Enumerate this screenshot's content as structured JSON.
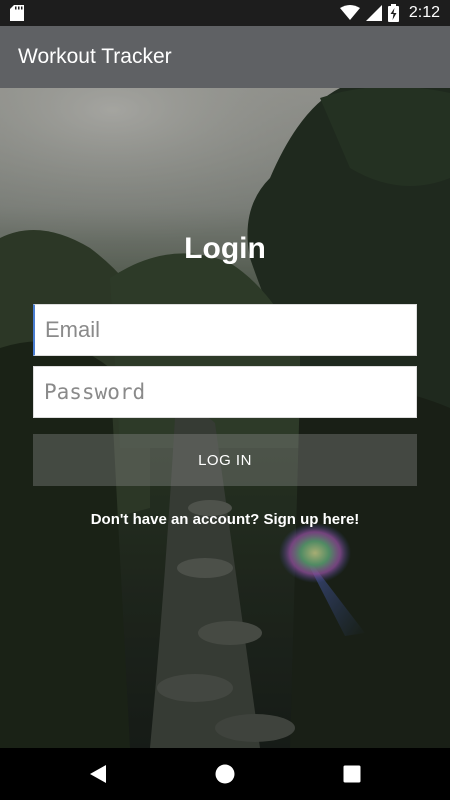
{
  "status_bar": {
    "time": "2:12",
    "icons": [
      "sd-card-icon",
      "wifi-icon",
      "signal-icon",
      "battery-charging-icon"
    ]
  },
  "app_bar": {
    "title": "Workout Tracker"
  },
  "login": {
    "title": "Login",
    "email_placeholder": "Email",
    "password_placeholder": "Password",
    "button_label": "LOG IN",
    "signup_text": "Don't have an account? Sign up here!"
  },
  "nav_bar": {
    "icons": [
      "back-icon",
      "home-icon",
      "recents-icon"
    ]
  },
  "colors": {
    "status_bar": "#1d1d1d",
    "app_bar": "#5f6164",
    "nav_bar": "#000000",
    "text": "#ffffff"
  }
}
